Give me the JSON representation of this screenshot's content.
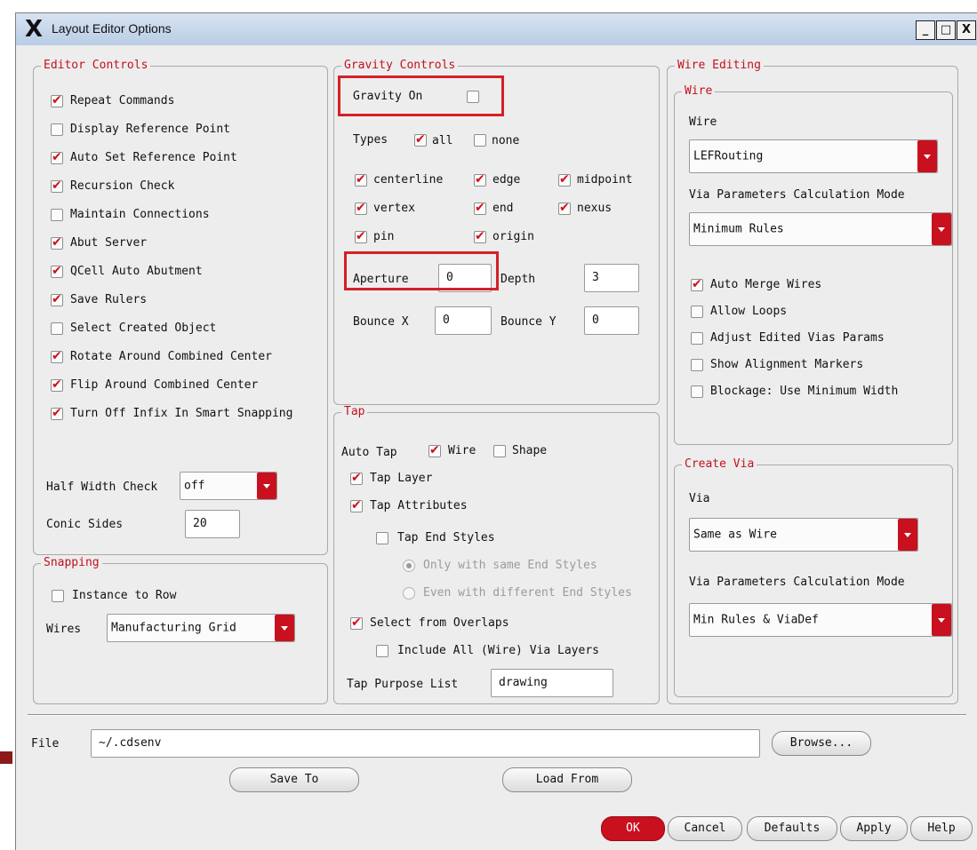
{
  "window": {
    "title": "Layout Editor Options",
    "buttons": [
      "_",
      "□",
      "X"
    ]
  },
  "editor_controls": {
    "title": "Editor Controls",
    "items": [
      {
        "label": "Repeat Commands",
        "checked": true
      },
      {
        "label": "Display Reference Point",
        "checked": false
      },
      {
        "label": "Auto Set Reference Point",
        "checked": true
      },
      {
        "label": "Recursion Check",
        "checked": true
      },
      {
        "label": "Maintain Connections",
        "checked": false
      },
      {
        "label": "Abut Server",
        "checked": true
      },
      {
        "label": "QCell Auto Abutment",
        "checked": true
      },
      {
        "label": "Save Rulers",
        "checked": true
      },
      {
        "label": "Select Created Object",
        "checked": false
      },
      {
        "label": "Rotate Around Combined Center",
        "checked": true
      },
      {
        "label": "Flip Around Combined Center",
        "checked": true
      },
      {
        "label": "Turn Off Infix In Smart Snapping",
        "checked": true
      }
    ],
    "half_width_label": "Half Width Check",
    "half_width_value": "off",
    "conic_label": "Conic Sides",
    "conic_value": "20"
  },
  "snapping": {
    "title": "Snapping",
    "instance_label": "Instance to Row",
    "instance_checked": false,
    "wires_label": "Wires",
    "wires_value": "Manufacturing Grid"
  },
  "gravity": {
    "title": "Gravity Controls",
    "on_label": "Gravity On",
    "on_checked": false,
    "types_label": "Types",
    "types": [
      {
        "label": "all",
        "checked": true
      },
      {
        "label": "none",
        "checked": false
      }
    ],
    "options": [
      {
        "label": "centerline",
        "checked": true
      },
      {
        "label": "edge",
        "checked": true
      },
      {
        "label": "midpoint",
        "checked": true
      },
      {
        "label": "vertex",
        "checked": true
      },
      {
        "label": "end",
        "checked": true
      },
      {
        "label": "nexus",
        "checked": true
      },
      {
        "label": "pin",
        "checked": true
      },
      {
        "label": "origin",
        "checked": true
      }
    ],
    "aperture_label": "Aperture",
    "aperture_value": "0",
    "depth_label": "Depth",
    "depth_value": "3",
    "bounce_x_label": "Bounce X",
    "bounce_x_value": "0",
    "bounce_y_label": "Bounce Y",
    "bounce_y_value": "0"
  },
  "tap": {
    "title": "Tap",
    "auto_tap_label": "Auto Tap",
    "wire_label": "Wire",
    "wire_checked": true,
    "shape_label": "Shape",
    "shape_checked": false,
    "tap_layer_label": "Tap Layer",
    "tap_layer_checked": true,
    "tap_attr_label": "Tap Attributes",
    "tap_attr_checked": true,
    "tap_end_label": "Tap End Styles",
    "tap_end_checked": false,
    "radio_same": "Only with same End Styles",
    "radio_diff": "Even with different End Styles",
    "select_overlap_label": "Select from Overlaps",
    "select_overlap_checked": true,
    "include_via_label": "Include All (Wire) Via Layers",
    "include_via_checked": false,
    "purpose_label": "Tap Purpose List",
    "purpose_value": "drawing"
  },
  "wire_editing": {
    "title": "Wire Editing",
    "wire_group_title": "Wire",
    "wire_label": "Wire",
    "wire_value": "LEFRouting",
    "via_mode_label": "Via Parameters Calculation Mode",
    "via_mode_value": "Minimum Rules",
    "options": [
      {
        "label": "Auto Merge Wires",
        "checked": true
      },
      {
        "label": "Allow Loops",
        "checked": false
      },
      {
        "label": "Adjust Edited Vias Params",
        "checked": false
      },
      {
        "label": "Show Alignment Markers",
        "checked": false
      },
      {
        "label": "Blockage: Use Minimum Width",
        "checked": false
      }
    ],
    "create_via_title": "Create Via",
    "via_label": "Via",
    "via_value": "Same as Wire",
    "via_mode2_label": "Via Parameters Calculation Mode",
    "via_mode2_value": "Min Rules & ViaDef"
  },
  "file": {
    "label": "File",
    "value": "~/.cdsenv",
    "browse": "Browse...",
    "save_to": "Save To",
    "load_from": "Load From"
  },
  "footer": {
    "ok": "OK",
    "cancel": "Cancel",
    "defaults": "Defaults",
    "apply": "Apply",
    "help": "Help"
  },
  "colors": {
    "accent": "#c8101e",
    "highlight": "#d42028",
    "background": "#ededed"
  }
}
